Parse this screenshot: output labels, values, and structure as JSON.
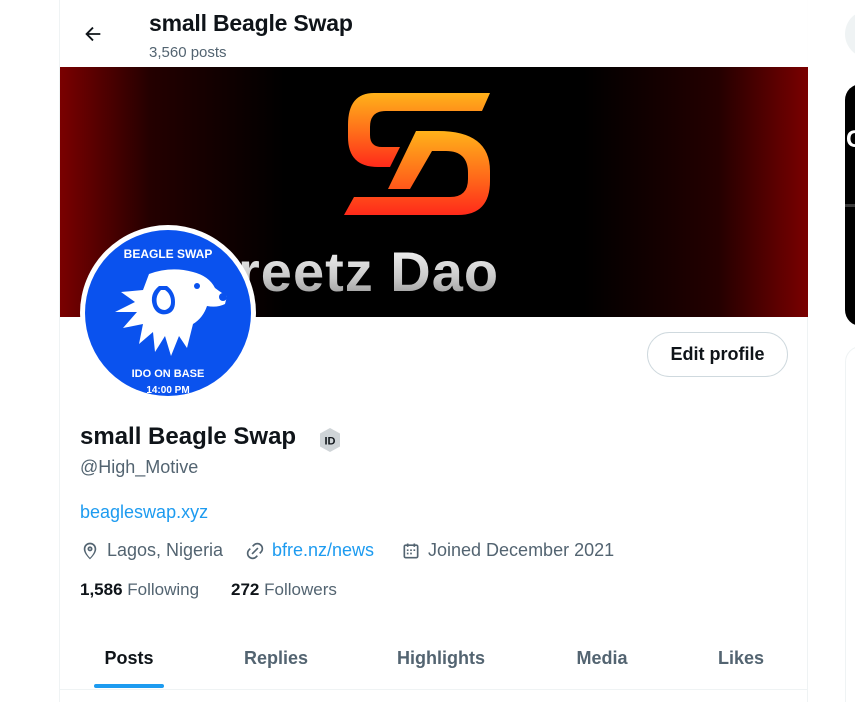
{
  "header": {
    "title": "small Beagle Swap",
    "posts_count": "3,560 posts"
  },
  "banner": {
    "text": "Streetz Dao",
    "logo_icon": "streetz-dao-logo"
  },
  "avatar": {
    "top_text": "BEAGLE SWAP",
    "bottom_text_1": "IDO ON BASE",
    "bottom_text_2": "14:00 PM",
    "background_color": "#0a52ee"
  },
  "actions": {
    "edit_profile_label": "Edit profile"
  },
  "profile": {
    "name": "small Beagle Swap",
    "badge_label": "ID",
    "handle": "@High_Motive",
    "website": "beagleswap.xyz",
    "location": "Lagos, Nigeria",
    "link": "bfre.nz/news",
    "joined": "Joined December 2021"
  },
  "stats": {
    "following_count": "1,586",
    "following_label": "Following",
    "followers_count": "272",
    "followers_label": "Followers"
  },
  "tabs": [
    {
      "label": "Posts",
      "active": true
    },
    {
      "label": "Replies",
      "active": false
    },
    {
      "label": "Highlights",
      "active": false
    },
    {
      "label": "Media",
      "active": false
    },
    {
      "label": "Likes",
      "active": false
    }
  ],
  "sidebar": {
    "card_text": "C"
  },
  "colors": {
    "accent": "#1d9bf0",
    "text_primary": "#0f1419",
    "text_secondary": "#536471"
  }
}
